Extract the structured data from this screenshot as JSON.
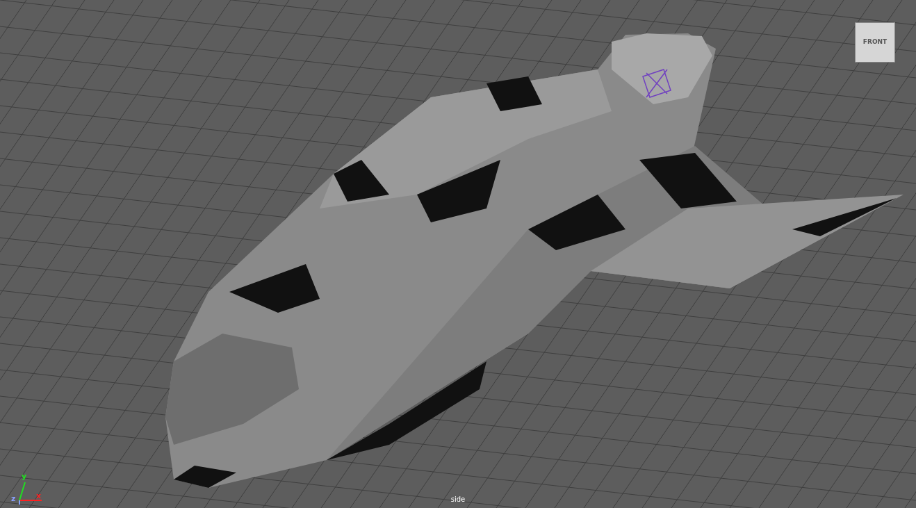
{
  "viewport": {
    "camera_label": "side",
    "view_cube": {
      "face_label": "FRONT"
    },
    "axes": [
      {
        "label": "x",
        "color": "#ff2020"
      },
      {
        "label": "y",
        "color": "#20e020"
      },
      {
        "label": "z",
        "color": "#8aa0ff"
      }
    ]
  }
}
